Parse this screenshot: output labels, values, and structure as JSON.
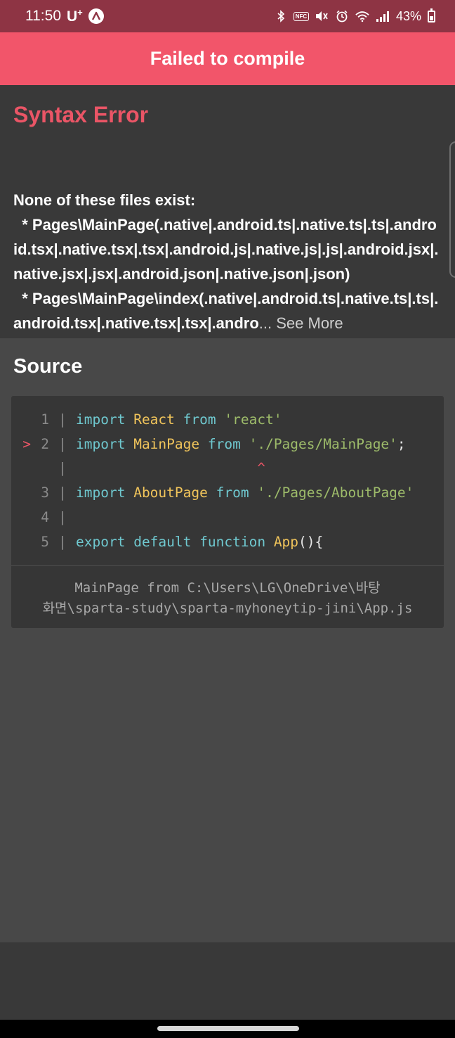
{
  "status_bar": {
    "time": "11:50",
    "carrier": "U",
    "carrier_plus": "+",
    "battery_percent": "43%",
    "nfc_label": "NFC"
  },
  "header": {
    "title": "Failed to compile"
  },
  "error": {
    "title": "Syntax Error",
    "message_line1": "None of these files exist:",
    "message_line2": "  * Pages\\MainPage(.native|.android.ts|.native.ts|.ts|.android.tsx|.native.tsx|.tsx|.android.js|.native.js|.js|.android.jsx|.native.jsx|.jsx|.android.json|.native.json|.json)",
    "message_line3": "  * Pages\\MainPage\\index(.native|.android.ts|.native.ts|.ts|.android.tsx|.native.tsx|.tsx|.andro",
    "see_more": "... See More"
  },
  "source": {
    "title": "Source",
    "lines": [
      {
        "marker": "",
        "number": "1",
        "tokens": [
          [
            "kw",
            "import"
          ],
          [
            "plain",
            " "
          ],
          [
            "id",
            "React"
          ],
          [
            "plain",
            " "
          ],
          [
            "kw",
            "from"
          ],
          [
            "plain",
            " "
          ],
          [
            "str",
            "'react'"
          ]
        ]
      },
      {
        "marker": ">",
        "number": "2",
        "tokens": [
          [
            "kw",
            "import"
          ],
          [
            "plain",
            " "
          ],
          [
            "id",
            "MainPage"
          ],
          [
            "plain",
            " "
          ],
          [
            "kw",
            "from"
          ],
          [
            "plain",
            " "
          ],
          [
            "str",
            "'./Pages/MainPage'"
          ],
          [
            "plain",
            ";"
          ]
        ]
      },
      {
        "marker": "",
        "number": "",
        "tokens": [
          [
            "caret",
            "                      ^"
          ]
        ]
      },
      {
        "marker": "",
        "number": "3",
        "tokens": [
          [
            "kw",
            "import"
          ],
          [
            "plain",
            " "
          ],
          [
            "id",
            "AboutPage"
          ],
          [
            "plain",
            " "
          ],
          [
            "kw",
            "from"
          ],
          [
            "plain",
            " "
          ],
          [
            "str",
            "'./Pages/AboutPage'"
          ]
        ]
      },
      {
        "marker": "",
        "number": "4",
        "tokens": []
      },
      {
        "marker": "",
        "number": "5",
        "tokens": [
          [
            "kw",
            "export"
          ],
          [
            "plain",
            " "
          ],
          [
            "kw",
            "default"
          ],
          [
            "plain",
            " "
          ],
          [
            "kw",
            "function"
          ],
          [
            "plain",
            " "
          ],
          [
            "id",
            "App"
          ],
          [
            "plain",
            "(){"
          ]
        ]
      }
    ],
    "footer_line1": "MainPage from C:\\Users\\LG\\OneDrive\\바탕",
    "footer_line2": "화면\\sparta-study\\sparta-myhoneytip-jini\\App.js"
  }
}
